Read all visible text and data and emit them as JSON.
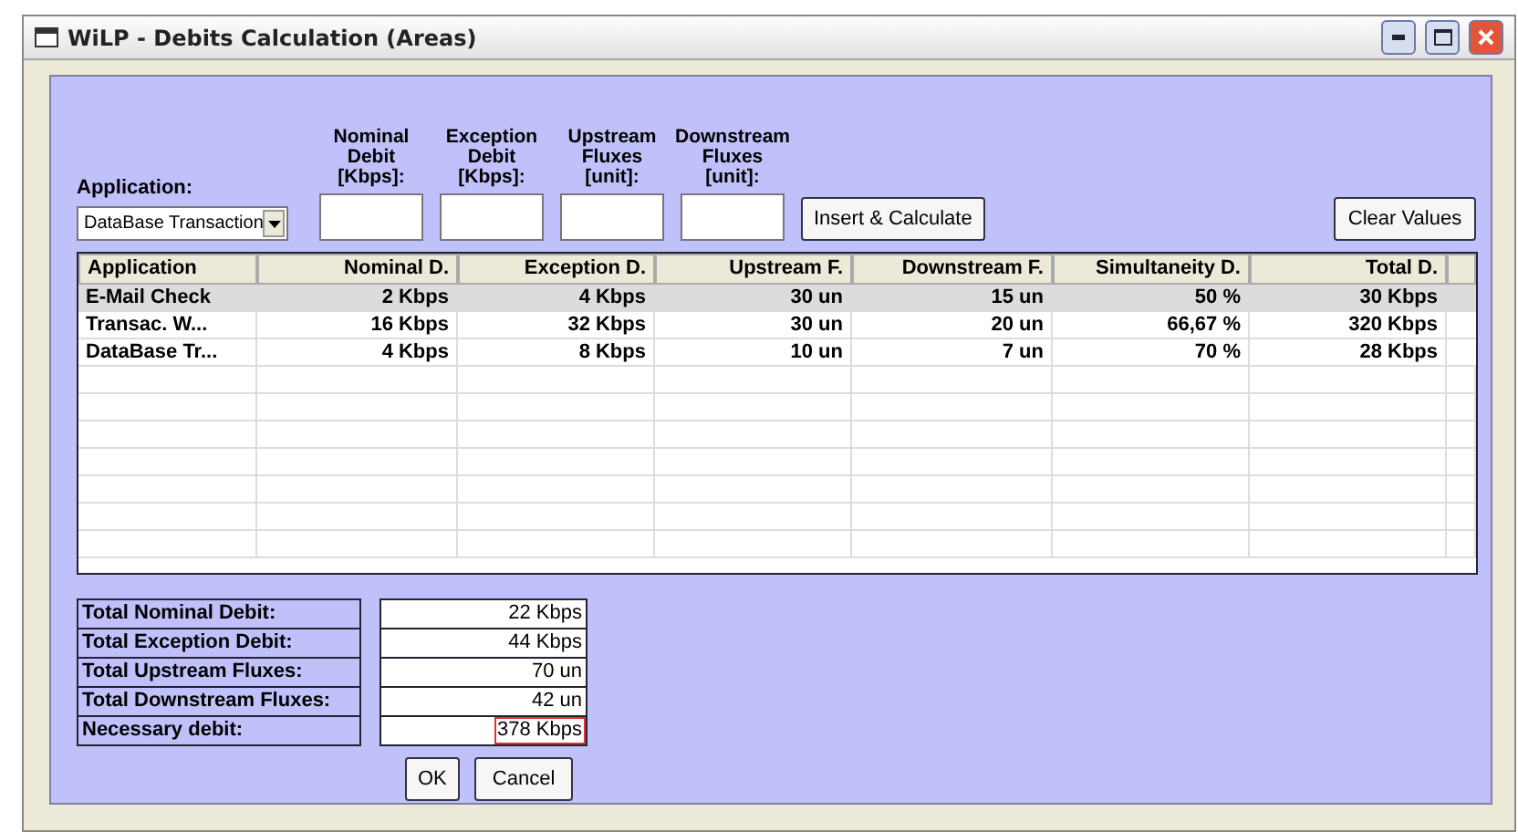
{
  "window": {
    "title": "WiLP - Debits Calculation (Areas)"
  },
  "form": {
    "application_label": "Application:",
    "application_value": "DataBase Transaction",
    "fields": [
      {
        "label": "Nominal Debit [Kbps]:"
      },
      {
        "label": "Exception Debit [Kbps]:"
      },
      {
        "label": "Upstream Fluxes [unit]:"
      },
      {
        "label": "Downstream Fluxes [unit]:"
      }
    ],
    "insert_button": "Insert & Calculate",
    "clear_button": "Clear Values"
  },
  "table": {
    "columns": [
      "Application",
      "Nominal D.",
      "Exception D.",
      "Upstream F.",
      "Downstream F.",
      "Simultaneity D.",
      "Total D."
    ],
    "rows": [
      {
        "selected": true,
        "cells": [
          "E-Mail Check",
          "2 Kbps",
          "4 Kbps",
          "30 un",
          "15 un",
          "50 %",
          "30 Kbps"
        ]
      },
      {
        "selected": false,
        "cells": [
          "Transac. W...",
          "16 Kbps",
          "32 Kbps",
          "30 un",
          "20 un",
          "66,67 %",
          "320 Kbps"
        ]
      },
      {
        "selected": false,
        "cells": [
          "DataBase Tr...",
          "4 Kbps",
          "8 Kbps",
          "10 un",
          "7 un",
          "70 %",
          "28 Kbps"
        ]
      }
    ]
  },
  "totals": [
    {
      "label": "Total Nominal Debit:",
      "value": "22 Kbps",
      "highlighted": false
    },
    {
      "label": "Total Exception Debit:",
      "value": "44 Kbps",
      "highlighted": false
    },
    {
      "label": "Total Upstream Fluxes:",
      "value": "70 un",
      "highlighted": false
    },
    {
      "label": "Total Downstream Fluxes:",
      "value": "42 un",
      "highlighted": false
    },
    {
      "label": "Necessary debit:",
      "value": "378 Kbps",
      "highlighted": true
    }
  ],
  "buttons": [
    "OK",
    "Cancel"
  ]
}
